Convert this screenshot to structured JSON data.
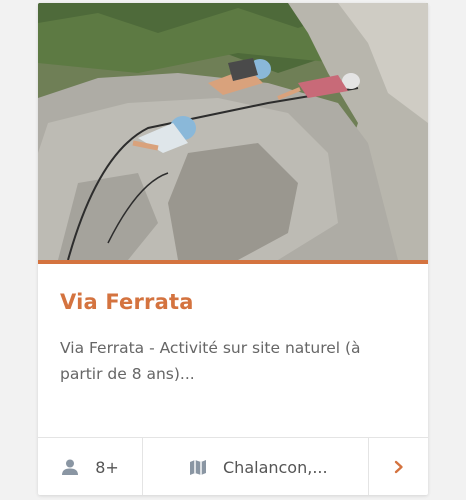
{
  "card": {
    "title": "Via Ferrata",
    "description": "Via Ferrata - Activité sur site naturel (à partir de 8 ans)...",
    "age": "8+",
    "location": "Chalancon,...",
    "icons": {
      "age": "person-icon",
      "location": "map-icon",
      "next": "chevron-right-icon"
    },
    "colors": {
      "accent": "#d4733f",
      "text": "#666666",
      "icon": "#8a96a3"
    }
  }
}
